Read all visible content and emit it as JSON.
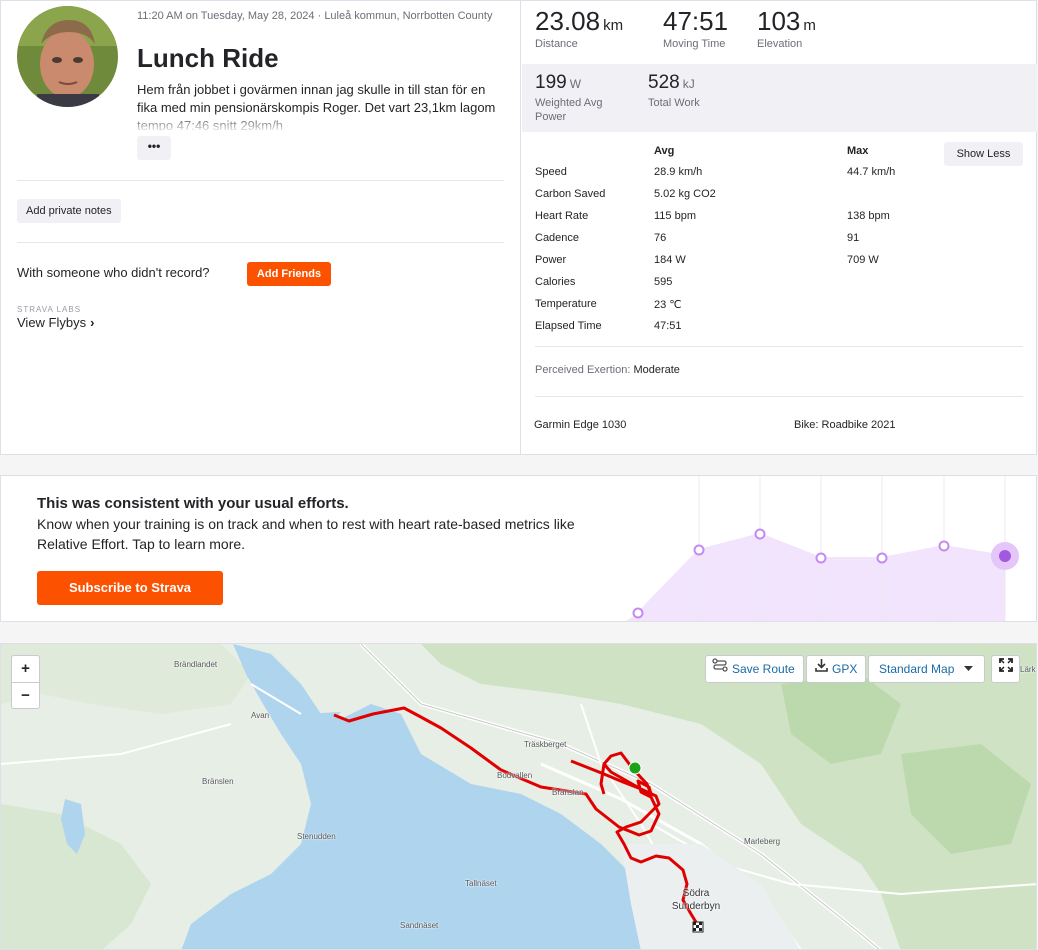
{
  "activity": {
    "meta": "11:20 AM on Tuesday, May 28, 2024 · Luleå kommun, Norrbotten County",
    "title": "Lunch Ride",
    "description": "Hem från jobbet i govärmen innan jag skulle in till stan för en fika med min pensionärskompis Roger. Det vart 23,1km lagom tempo 47:46 snitt 29km/h",
    "more_label": "•••",
    "private_notes_label": "Add private notes",
    "with_someone_text": "With someone who didn't record?",
    "add_friends_label": "Add Friends",
    "labs_label": "STRAVA LABS",
    "flybys_label": "View Flybys",
    "flybys_chevron": "›"
  },
  "summary": {
    "distance": {
      "value": "23.08",
      "unit": "km",
      "label": "Distance"
    },
    "moving_time": {
      "value": "47:51",
      "unit": "",
      "label": "Moving Time"
    },
    "elevation": {
      "value": "103",
      "unit": "m",
      "label": "Elevation"
    },
    "weighted_power": {
      "value": "199",
      "unit": "W",
      "label": "Weighted Avg Power"
    },
    "total_work": {
      "value": "528",
      "unit": "kJ",
      "label": "Total Work"
    }
  },
  "details": {
    "avg_header": "Avg",
    "max_header": "Max",
    "show_less_label": "Show Less",
    "rows": [
      {
        "label": "Speed",
        "avg": "28.9 km/h",
        "max": "44.7 km/h"
      },
      {
        "label": "Carbon Saved",
        "avg": "5.02 kg CO2",
        "max": ""
      },
      {
        "label": "Heart Rate",
        "avg": "115 bpm",
        "max": "138 bpm"
      },
      {
        "label": "Cadence",
        "avg": "76",
        "max": "91"
      },
      {
        "label": "Power",
        "avg": "184 W",
        "max": "709 W"
      },
      {
        "label": "Calories",
        "avg": "595",
        "max": ""
      },
      {
        "label": "Temperature",
        "avg": "23 ℃",
        "max": ""
      },
      {
        "label": "Elapsed Time",
        "avg": "47:51",
        "max": ""
      }
    ],
    "perceived_label": "Perceived Exertion:",
    "perceived_value": "Moderate",
    "device": "Garmin Edge 1030",
    "bike": "Bike: Roadbike 2021"
  },
  "relative_effort": {
    "title": "This was consistent with your usual efforts.",
    "text": "Know when your training is on track and when to rest with heart rate-based metrics like Relative Effort. Tap to learn more.",
    "subscribe_label": "Subscribe to Strava",
    "accent_color": "#a259e0",
    "fill_color": "#f1e4fc"
  },
  "map": {
    "zoom_in": "+",
    "zoom_out": "−",
    "save_route_label": "Save Route",
    "gpx_label": "GPX",
    "map_type_label": "Standard Map",
    "route_color": "#e00000",
    "labels": {
      "brandlandet": "Brändlandet",
      "avan": "Avan",
      "branslen_w": "Bränslen",
      "stenudden": "Stenudden",
      "traskberget": "Träskberget",
      "bodvallen": "Bodvallen",
      "branslan": "Bränslan",
      "marleberg": "Marleberg",
      "tallnaset": "Tallnäset",
      "sandnaset": "Sandnäset",
      "sodra": "Södra",
      "sunderbyn": "Sunderbyn",
      "larke": "Lärke"
    }
  }
}
